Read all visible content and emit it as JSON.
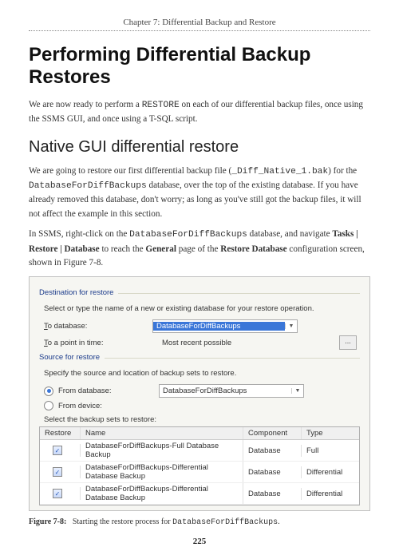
{
  "chapter": "Chapter 7: Differential Backup and Restore",
  "h1": "Performing Differential Backup Restores",
  "p1a": "We are now ready to perform a ",
  "p1_code": "RESTORE",
  "p1b": " on each of our differential backup files, once using the SSMS GUI, and once using a T-SQL script.",
  "h2": "Native GUI differential restore",
  "p2a": "We are going to restore our first differential backup file (",
  "p2_code1": "_Diff_Native_1.bak",
  "p2b": ") for the ",
  "p2_code2": "DatabaseForDiffBackups",
  "p2c": " database, over the top of the existing database. If you have already removed this database, don't worry; as long as you've still got the backup files, it will not affect the example in this section.",
  "p3a": "In SSMS, right-click on the ",
  "p3_code": "DatabaseForDiffBackups",
  "p3b": " database, and navigate ",
  "p3_bold1": "Tasks | Restore | Database",
  "p3c": " to reach the ",
  "p3_bold2": "General",
  "p3d": " page of the ",
  "p3_bold3": "Restore Database",
  "p3e": " configuration screen, shown in Figure 7-8.",
  "ui": {
    "dest_group": "Destination for restore",
    "dest_hint": "Select or type the name of a new or existing database for your restore operation.",
    "to_db": "o database:",
    "to_db_u": "T",
    "to_db_value": "DatabaseForDiffBackups",
    "point_time": "o a point in time:",
    "point_time_u": "T",
    "point_time_value": "Most recent possible",
    "ellipsis": "...",
    "src_group": "Source for restore",
    "src_hint": "Specify the source and location of backup sets to restore.",
    "from_db": "From database:",
    "from_db_value": "DatabaseForDiffBackups",
    "from_device": "From device:",
    "select_sets": "Select the backup sets to restore:",
    "col_restore": "Restore",
    "col_name": "Name",
    "col_comp": "Component",
    "col_type": "Type",
    "rows": [
      {
        "name": "DatabaseForDiffBackups-Full Database Backup",
        "comp": "Database",
        "type": "Full"
      },
      {
        "name": "DatabaseForDiffBackups-Differential Database Backup",
        "comp": "Database",
        "type": "Differential"
      },
      {
        "name": "DatabaseForDiffBackups-Differential Database Backup",
        "comp": "Database",
        "type": "Differential"
      }
    ]
  },
  "fig_label": "Figure 7-8:",
  "fig_text_a": "Starting the restore process for ",
  "fig_code": "DatabaseForDiffBackups",
  "fig_text_b": ".",
  "page_number": "225"
}
